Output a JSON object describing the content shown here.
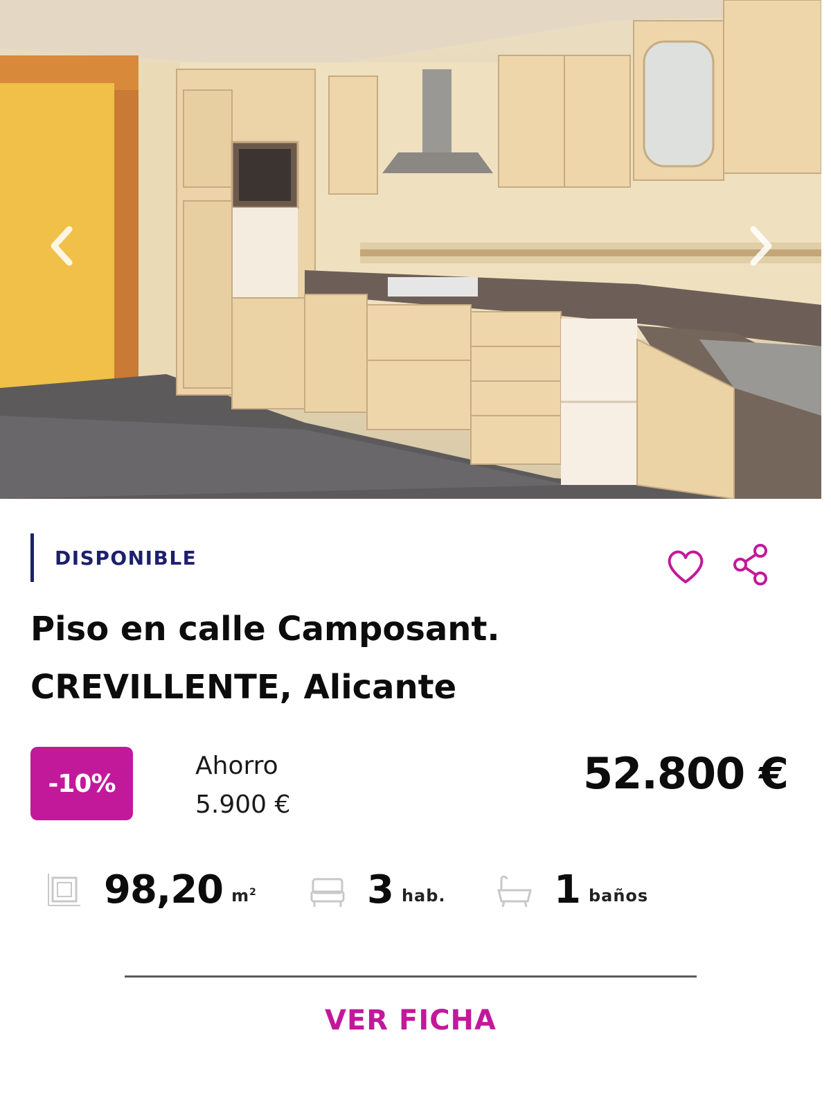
{
  "listing": {
    "status": "DISPONIBLE",
    "title_line1": "Piso en calle Camposant.",
    "title_line2": "CREVILLENTE, Alicante",
    "discount": "-10%",
    "savings_label": "Ahorro",
    "savings_amount": "5.900 €",
    "price": "52.800 €"
  },
  "features": {
    "area_value": "98,20",
    "area_unit": "m",
    "area_unit_exp": "2",
    "rooms_value": "3",
    "rooms_unit": "hab.",
    "baths_value": "1",
    "baths_unit": "baños"
  },
  "actions": {
    "cta": "VER FICHA"
  },
  "icons": {
    "prev": "chevron-left-icon",
    "next": "chevron-right-icon",
    "favorite": "heart-icon",
    "share": "share-icon",
    "area": "area-icon",
    "rooms": "bed-icon",
    "baths": "bathtub-icon"
  },
  "colors": {
    "accent": "#c2199b",
    "status": "#1d1f6e",
    "text": "#0c0c0c"
  }
}
